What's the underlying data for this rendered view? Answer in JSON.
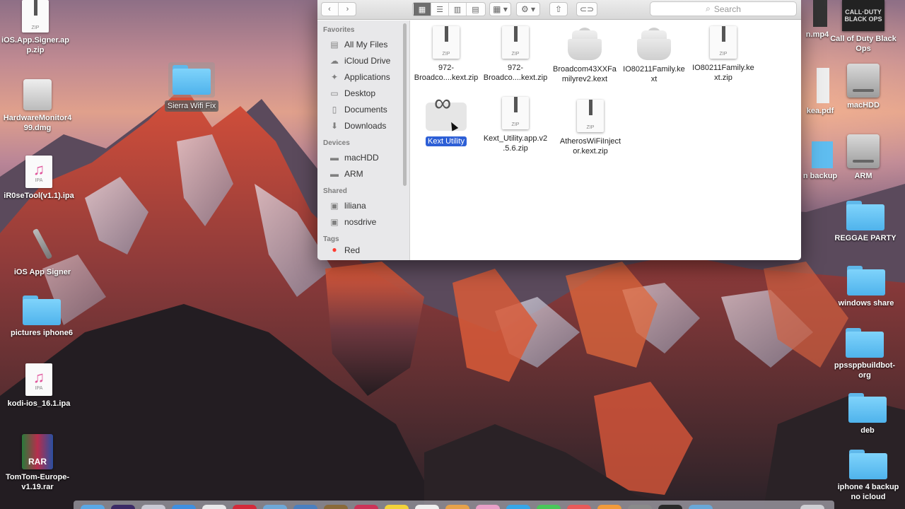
{
  "desktop": {
    "left_icons": [
      {
        "name": "ios-app-signer-zip",
        "label": "iOS.App.Signer.ap\np.zip",
        "kind": "zip"
      },
      {
        "name": "hardware-monitor-dmg",
        "label": "HardwareMonitor4\n99.dmg",
        "kind": "dmg"
      },
      {
        "name": "ir0setool-ipa",
        "label": "iR0seTool(v1.1).ipa",
        "kind": "ipa"
      },
      {
        "name": "ios-app-signer-app",
        "label": "iOS App Signer",
        "kind": "pen"
      },
      {
        "name": "pictures-iphone6-folder",
        "label": "pictures iphone6",
        "kind": "folder"
      },
      {
        "name": "kodi-ipa",
        "label": "kodi-ios_16.1.ipa",
        "kind": "ipa"
      },
      {
        "name": "tomtom-rar",
        "label": "TomTom-Europe-\nv1.19.rar",
        "kind": "rar"
      }
    ],
    "drag_folder": {
      "label": "Sierra Wifi Fix"
    },
    "right_icons": [
      {
        "name": "call-of-duty",
        "label": "Call of Duty Black\nOps",
        "kind": "cod"
      },
      {
        "name": "machdd-drive",
        "label": "macHDD",
        "kind": "hdd"
      },
      {
        "name": "arm-drive",
        "label": "ARM",
        "kind": "hdd"
      },
      {
        "name": "reggae-party-folder",
        "label": "REGGAE PARTY",
        "kind": "folder"
      },
      {
        "name": "windows-share-folder",
        "label": "windows share",
        "kind": "folder"
      },
      {
        "name": "ppsspp-folder",
        "label": "ppssppbuildbot-\norg",
        "kind": "folder"
      },
      {
        "name": "deb-folder",
        "label": "deb",
        "kind": "folder"
      },
      {
        "name": "iphone4-backup-folder",
        "label": "iphone 4 backup\nno icloud",
        "kind": "folder"
      }
    ],
    "partial_labels": {
      "mp4": "n.mp4",
      "pdf": "kea.pdf",
      "backup": "n backup"
    }
  },
  "finder": {
    "search_placeholder": "Search",
    "sidebar": {
      "favorites_title": "Favorites",
      "favorites": [
        {
          "label": "All My Files",
          "icon": "all-files-icon"
        },
        {
          "label": "iCloud Drive",
          "icon": "cloud-icon"
        },
        {
          "label": "Applications",
          "icon": "applications-icon"
        },
        {
          "label": "Desktop",
          "icon": "desktop-icon"
        },
        {
          "label": "Documents",
          "icon": "documents-icon"
        },
        {
          "label": "Downloads",
          "icon": "downloads-icon"
        }
      ],
      "devices_title": "Devices",
      "devices": [
        {
          "label": "macHDD",
          "icon": "disk-icon"
        },
        {
          "label": "ARM",
          "icon": "disk-icon"
        }
      ],
      "shared_title": "Shared",
      "shared": [
        {
          "label": "liliana",
          "icon": "computer-icon"
        },
        {
          "label": "nosdrive",
          "icon": "computer-icon"
        }
      ],
      "tags_title": "Tags",
      "tags": [
        {
          "label": "Red",
          "color": "#ff3b30"
        }
      ]
    },
    "files": [
      {
        "label": "972-\nBroadco....kext.zip",
        "kind": "zip"
      },
      {
        "label": "972-\nBroadco....kext.zip",
        "kind": "zip"
      },
      {
        "label": "Broadcom43XXFa\nmilyrev2.kext",
        "kind": "kext"
      },
      {
        "label": "IO80211Family.ke\nxt",
        "kind": "kext"
      },
      {
        "label": "IO80211Family.ke\nxt.zip",
        "kind": "zip"
      },
      {
        "label": "Kext Utility",
        "kind": "app",
        "selected": true
      },
      {
        "label": "Kext_Utility.app.v2\n.5.6.zip",
        "kind": "zip"
      },
      {
        "label": "AtherosWiFiInject\nor.kext.zip",
        "kind": "zip"
      }
    ]
  },
  "icons": {
    "zip_text": "ZIP",
    "ipa_text": "IPA",
    "rar_text": "RAR",
    "cod_text": "CALL·DUTY\nBLACK OPS"
  },
  "colors": {
    "selection": "#2d5fd6",
    "folder": "#6ec8f6",
    "tag_red": "#ff3b30"
  }
}
